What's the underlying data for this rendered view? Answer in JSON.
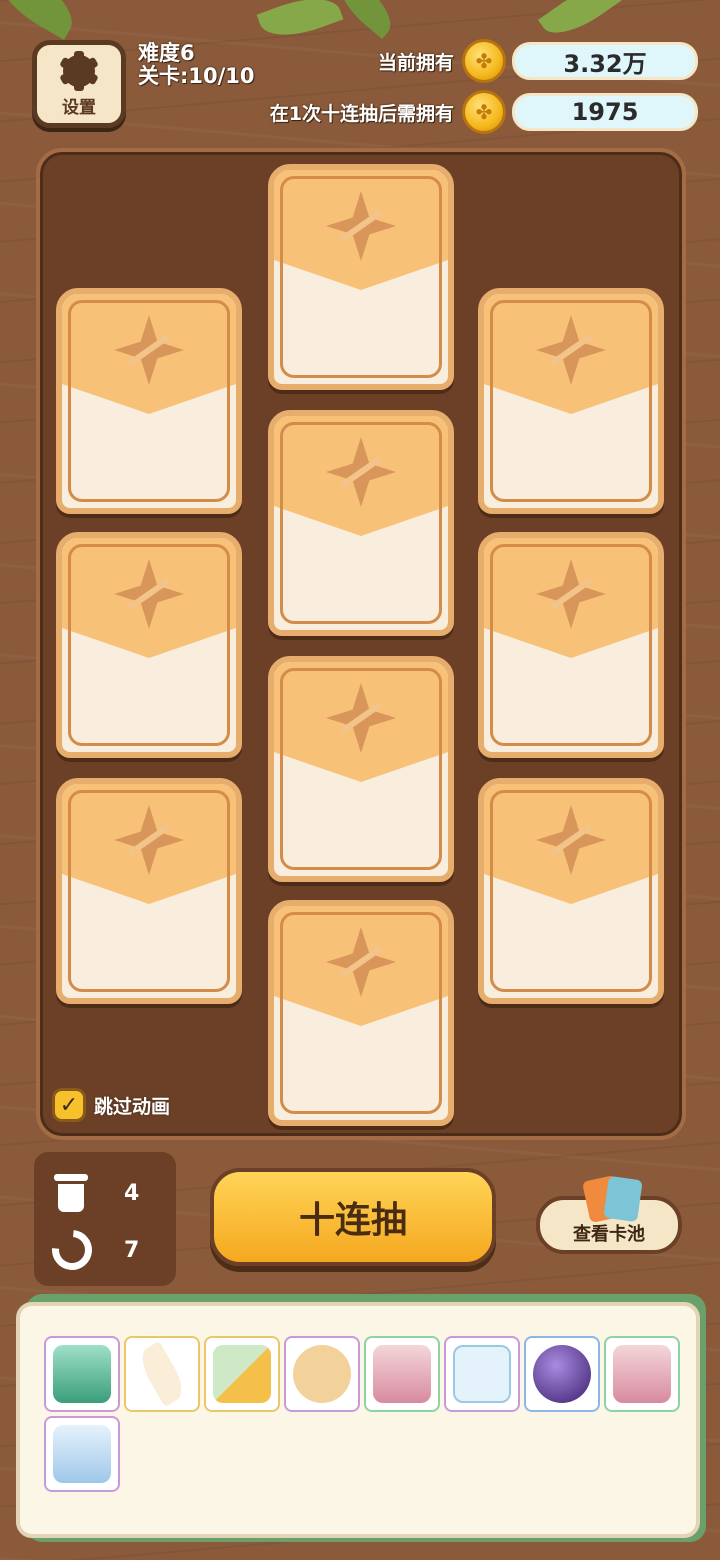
{
  "settings": {
    "label": "设置",
    "icon": "gear-icon"
  },
  "level": {
    "difficulty": "难度6",
    "stage": "关卡:10/10"
  },
  "resources": [
    {
      "label": "当前拥有",
      "icon": "coin-icon",
      "value": "3.32万"
    },
    {
      "label": "在1次十连抽后需拥有",
      "icon": "coin-icon",
      "value": "1975"
    }
  ],
  "skip_animation": {
    "label": "跳过动画",
    "checked": true
  },
  "tools": {
    "trash_count": "4",
    "undo_count": "7"
  },
  "draw_button": {
    "label": "十连抽"
  },
  "pool_button": {
    "label": "查看卡池"
  },
  "inventory": {
    "items": [
      {
        "icon": "green-card-pack-icon",
        "rarity": "purple"
      },
      {
        "icon": "feather-charm-icon",
        "rarity": "gold"
      },
      {
        "icon": "card-swap-icon",
        "rarity": "gold"
      },
      {
        "icon": "potato-icon",
        "rarity": "purple"
      },
      {
        "icon": "card-coins-x2-icon",
        "rarity": "green"
      },
      {
        "icon": "dice-plus-icon",
        "rarity": "purple"
      },
      {
        "icon": "star-orb-icon",
        "rarity": "blue"
      },
      {
        "icon": "card-coins-icon",
        "rarity": "green"
      },
      {
        "icon": "mystery-card-plus-icon",
        "rarity": "purple"
      }
    ]
  },
  "colors": {
    "wood": "#8a5a3b",
    "board": "#6b4026",
    "card_top": "#f7c178",
    "button": "#f5a81f",
    "value_box": "#dff7fb"
  }
}
